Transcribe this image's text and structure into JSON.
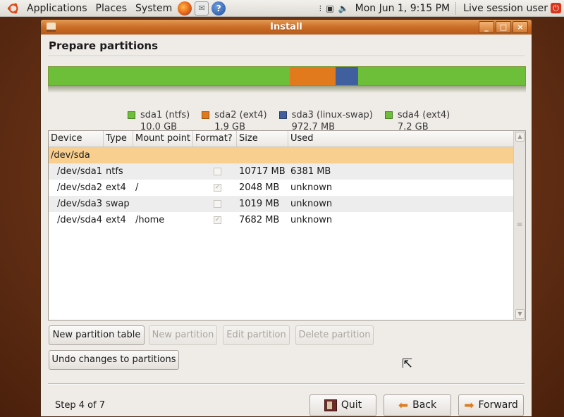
{
  "top_panel": {
    "menus": [
      "Applications",
      "Places",
      "System"
    ],
    "clock": "Mon Jun  1,  9:15 PM",
    "session": "Live session user"
  },
  "window": {
    "title": "Install",
    "wm_buttons": [
      "_",
      "□",
      "×"
    ]
  },
  "page": {
    "title": "Prepare partitions"
  },
  "partition_bar": {
    "segments": [
      {
        "name": "sda1",
        "color": "#6dbf3a",
        "fraction": 0.506
      },
      {
        "name": "sda2",
        "color": "#e07a1c",
        "fraction": 0.096
      },
      {
        "name": "sda3",
        "color": "#3f5f9f",
        "fraction": 0.048
      },
      {
        "name": "sda4",
        "color": "#6dbf3a",
        "fraction": 0.35
      }
    ]
  },
  "legend": [
    {
      "label": "sda1 (ntfs)",
      "size": "10.0 GB",
      "color": "#6dbf3a"
    },
    {
      "label": "sda2 (ext4)",
      "size": "1.9 GB",
      "color": "#e07a1c"
    },
    {
      "label": "sda3 (linux-swap)",
      "size": "972.7 MB",
      "color": "#3f5f9f"
    },
    {
      "label": "sda4 (ext4)",
      "size": "7.2 GB",
      "color": "#6dbf3a"
    }
  ],
  "table": {
    "headers": [
      "Device",
      "Type",
      "Mount point",
      "Format?",
      "Size",
      "Used"
    ],
    "disk": "/dev/sda",
    "rows": [
      {
        "device": "/dev/sda1",
        "type": "ntfs",
        "mount": "",
        "format": false,
        "size": "10717 MB",
        "used": "6381 MB"
      },
      {
        "device": "/dev/sda2",
        "type": "ext4",
        "mount": "/",
        "format": true,
        "size": "2048 MB",
        "used": "unknown"
      },
      {
        "device": "/dev/sda3",
        "type": "swap",
        "mount": "",
        "format": false,
        "size": "1019 MB",
        "used": "unknown"
      },
      {
        "device": "/dev/sda4",
        "type": "ext4",
        "mount": "/home",
        "format": true,
        "size": "7682 MB",
        "used": "unknown"
      }
    ]
  },
  "actions": {
    "new_table": "New partition table",
    "new_partition": "New partition",
    "edit_partition": "Edit partition",
    "delete_partition": "Delete partition",
    "undo": "Undo changes to partitions"
  },
  "footer": {
    "step": "Step 4 of 7",
    "quit": "Quit",
    "back": "Back",
    "forward": "Forward"
  }
}
